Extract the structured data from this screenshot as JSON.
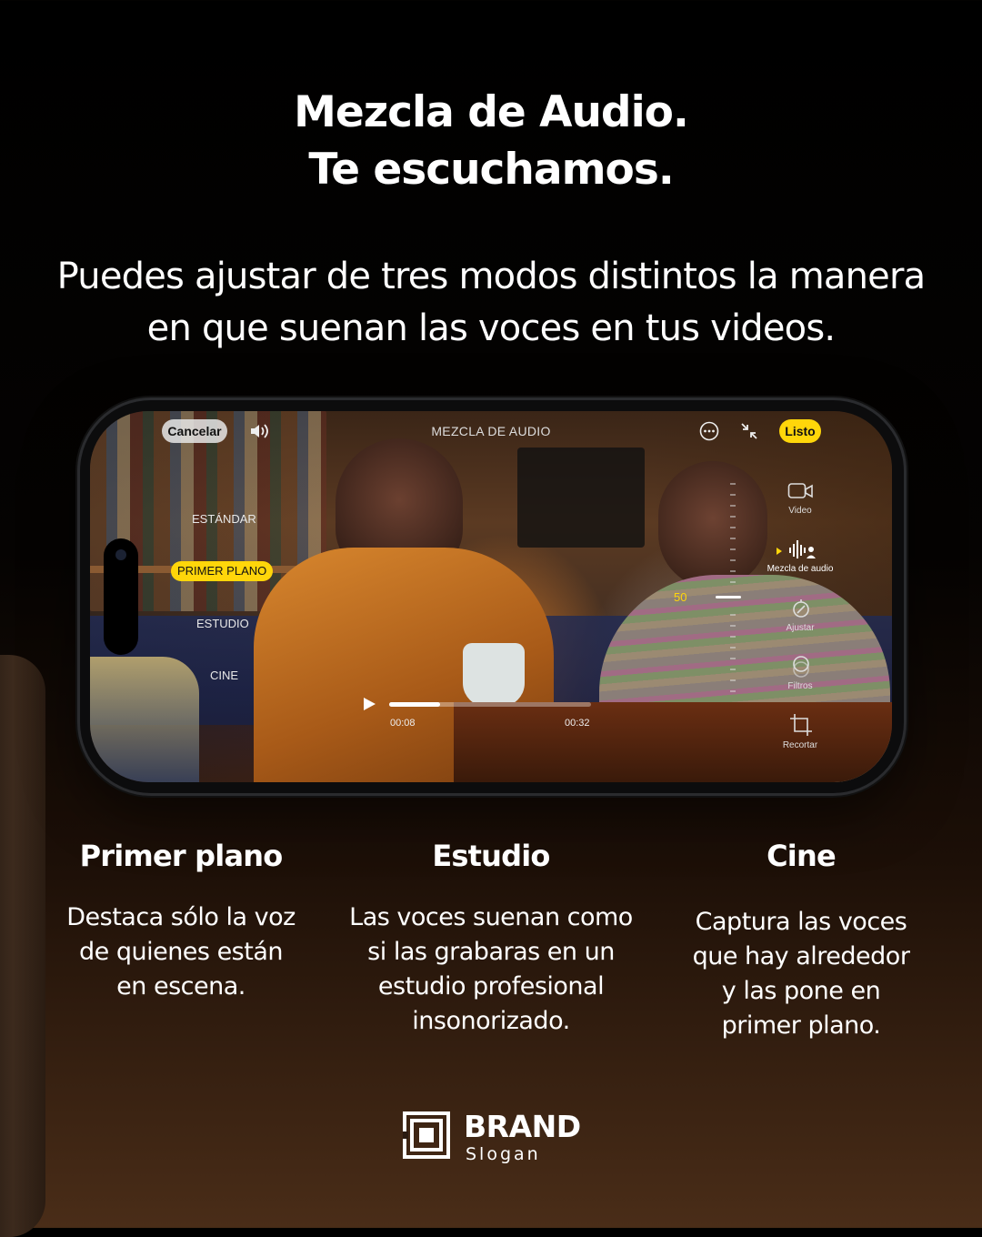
{
  "headline": [
    "Mezcla de Audio.",
    "Te escuchamos."
  ],
  "subheadline": [
    "Puedes ajustar de tres modos distintos la manera",
    "en que suenan las voces en tus videos."
  ],
  "phone_ui": {
    "cancel_label": "Cancelar",
    "screen_title": "MEZCLA DE AUDIO",
    "done_label": "Listo",
    "modes": [
      "ESTÁNDAR",
      "PRIMER PLANO",
      "ESTUDIO",
      "CINE"
    ],
    "selected_mode": "PRIMER PLANO",
    "intensity_value": "50",
    "tools": [
      {
        "label": "Video",
        "icon": "video-camera-icon"
      },
      {
        "label": "Mezcla de audio",
        "icon": "audio-waveform-icon"
      },
      {
        "label": "Ajustar",
        "icon": "adjust-dial-icon"
      },
      {
        "label": "Filtros",
        "icon": "filters-icon"
      },
      {
        "label": "Recortar",
        "icon": "crop-icon"
      }
    ],
    "current_time": "00:08",
    "total_time": "00:32",
    "playback_progress": 0.25
  },
  "features": [
    {
      "title": "Primer plano",
      "body": [
        "Destaca sólo la voz",
        "de quienes están",
        "en escena."
      ]
    },
    {
      "title": "Estudio",
      "body": [
        "Las voces suenan como",
        "si las grabaras en un",
        "estudio profesional",
        "insonorizado."
      ]
    },
    {
      "title": "Cine",
      "body": [
        "Captura las voces",
        "que hay alrededor",
        "y las pone en",
        "primer plano."
      ]
    }
  ],
  "brand": {
    "name": "BRAND",
    "slogan": "Slogan",
    "logo_icon": "concentric-squares-logo-icon"
  },
  "colors": {
    "accent": "#ffd60a",
    "background_top": "#000000",
    "background_bottom": "#4a2d18"
  }
}
